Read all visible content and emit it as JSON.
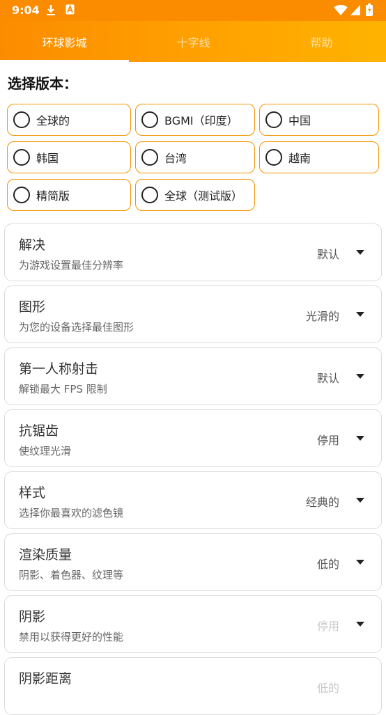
{
  "status_bar": {
    "time": "9:04"
  },
  "tabs": [
    {
      "label": "环球影城"
    },
    {
      "label": "十字线"
    },
    {
      "label": "帮助"
    }
  ],
  "version_section": {
    "title": "选择版本：",
    "options": [
      {
        "label": "全球的"
      },
      {
        "label": "BGMI（印度）"
      },
      {
        "label": "中国"
      },
      {
        "label": "韩国"
      },
      {
        "label": "台湾"
      },
      {
        "label": "越南"
      },
      {
        "label": "精简版"
      },
      {
        "label": "全球（测试版）"
      }
    ]
  },
  "settings": [
    {
      "title": "解决",
      "subtitle": "为游戏设置最佳分辨率",
      "value": "默认",
      "enabled": true
    },
    {
      "title": "图形",
      "subtitle": "为您的设备选择最佳图形",
      "value": "光滑的",
      "enabled": true
    },
    {
      "title": "第一人称射击",
      "subtitle": "解锁最大 FPS 限制",
      "value": "默认",
      "enabled": true
    },
    {
      "title": "抗锯齿",
      "subtitle": "使纹理光滑",
      "value": "停用",
      "enabled": true
    },
    {
      "title": "样式",
      "subtitle": "选择你最喜欢的滤色镜",
      "value": "经典的",
      "enabled": true
    },
    {
      "title": "渲染质量",
      "subtitle": "阴影、着色器、纹理等",
      "value": "低的",
      "enabled": true
    },
    {
      "title": "阴影",
      "subtitle": "禁用以获得更好的性能",
      "value": "停用",
      "enabled": false
    },
    {
      "title": "阴影距离",
      "subtitle": "",
      "value": "低的",
      "enabled": false
    }
  ]
}
